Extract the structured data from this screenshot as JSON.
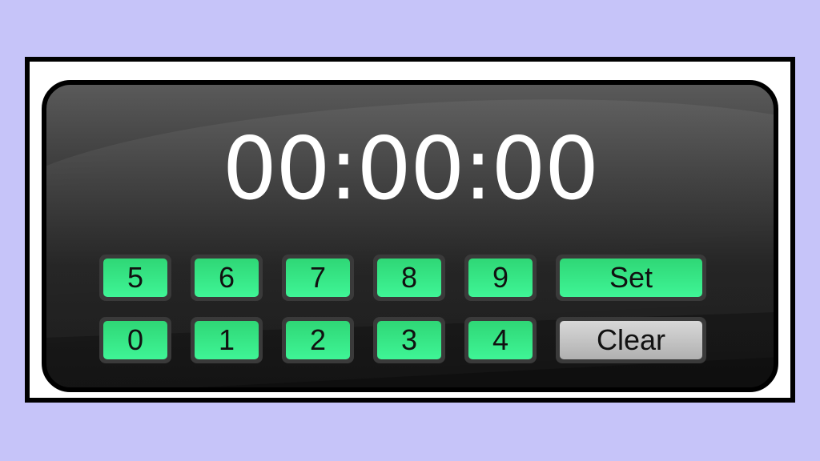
{
  "timer": {
    "display": "00:00:00"
  },
  "keypad": {
    "row1": [
      "5",
      "6",
      "7",
      "8",
      "9"
    ],
    "row2": [
      "0",
      "1",
      "2",
      "3",
      "4"
    ],
    "set_label": "Set",
    "clear_label": "Clear"
  },
  "colors": {
    "background": "#c6c4f9",
    "key_green": "#3ff596",
    "key_gray": "#c4c4c4",
    "panel": "#1c1c1c",
    "display_text": "#ffffff"
  }
}
